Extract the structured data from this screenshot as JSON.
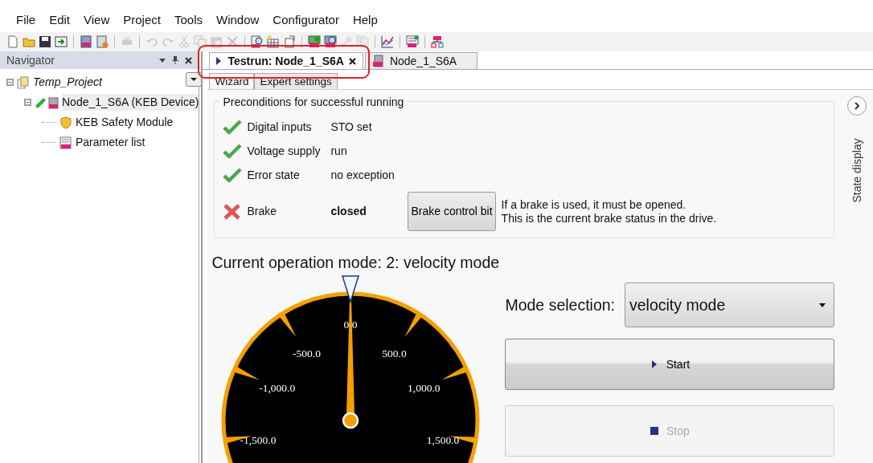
{
  "menu": [
    "File",
    "Edit",
    "View",
    "Project",
    "Tools",
    "Window",
    "Configurator",
    "Help"
  ],
  "toolbar": [
    {
      "disabled": false
    },
    {
      "disabled": false
    },
    {
      "disabled": false
    },
    {
      "disabled": false
    },
    {
      "disabled": false
    },
    {
      "disabled": false
    },
    {
      "disabled": true
    },
    {
      "disabled": true
    },
    {
      "disabled": true
    },
    {
      "disabled": true
    },
    {
      "disabled": true
    },
    {
      "disabled": true
    },
    {
      "disabled": true
    },
    {
      "disabled": false
    },
    {
      "disabled": false
    },
    {
      "disabled": false
    },
    {
      "disabled": false
    },
    {
      "disabled": false
    },
    {
      "disabled": true
    },
    {
      "disabled": true
    },
    {
      "disabled": false
    },
    {
      "disabled": false
    },
    {
      "disabled": false
    }
  ],
  "navigator": {
    "title": "Navigator",
    "tree": [
      {
        "label": "Temp_Project",
        "kind": "project",
        "expanded": true,
        "selected": false,
        "children": [
          {
            "label": "Node_1_S6A (KEB Device)",
            "kind": "device",
            "expanded": true,
            "selected": true,
            "children": [
              {
                "label": "KEB Safety Module",
                "kind": "safety",
                "selected": false
              },
              {
                "label": "Parameter list",
                "kind": "list",
                "selected": false
              }
            ]
          }
        ]
      }
    ]
  },
  "doc_tabs": [
    {
      "label": "Testrun: Node_1_S6A",
      "selected": true,
      "closable": true
    },
    {
      "label": "Node_1_S6A",
      "selected": false,
      "closable": false
    }
  ],
  "sub_tabs": [
    {
      "label": "Wizard",
      "selected": true
    },
    {
      "label": "Expert settings",
      "selected": false
    }
  ],
  "preconditions": {
    "title": "Preconditions for successful running",
    "rows": [
      {
        "label": "Digital inputs",
        "value": "STO set",
        "ok": true
      },
      {
        "label": "Voltage supply",
        "value": "run",
        "ok": true
      },
      {
        "label": "Error state",
        "value": "no exception",
        "ok": true
      },
      {
        "label": "Brake",
        "value": "closed",
        "ok": false,
        "button": "Brake control bit",
        "note": "If a brake is used, it must be opened.\nThis is the current brake status in the drive."
      }
    ]
  },
  "operation_mode": "Current operation mode: 2: velocity mode",
  "gauge": {
    "labels": [
      "-1,500.0",
      "-1,000.0",
      "-500.0",
      "0.0",
      "500.0",
      "1,000.0",
      "1,500.0"
    ]
  },
  "mode_selection": {
    "label": "Mode selection:",
    "value": "velocity mode"
  },
  "buttons": [
    {
      "label": "Start",
      "kind": "start",
      "disabled": false
    },
    {
      "label": "Stop",
      "kind": "stop",
      "disabled": true
    }
  ],
  "side_panel": {
    "label": "State display"
  }
}
